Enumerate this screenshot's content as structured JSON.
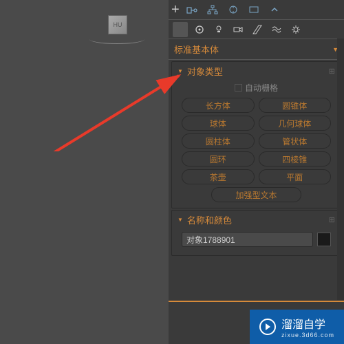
{
  "viewport": {
    "cube_label": "HU"
  },
  "panel": {
    "dropdown": "标准基本体",
    "sections": {
      "object_type": {
        "title": "对象类型",
        "auto_grid": "自动栅格",
        "buttons": {
          "box": "长方体",
          "cone": "圆锥体",
          "sphere": "球体",
          "geosphere": "几何球体",
          "cylinder": "圆柱体",
          "tube": "管状体",
          "torus": "圆环",
          "pyramid": "四棱锥",
          "teapot": "茶壶",
          "plane": "平面",
          "textplus": "加强型文本"
        }
      },
      "name_color": {
        "title": "名称和颜色",
        "object_name": "对象1788901"
      }
    }
  },
  "watermark": {
    "brand": "溜溜自学",
    "url": "zixue.3d66.com"
  }
}
